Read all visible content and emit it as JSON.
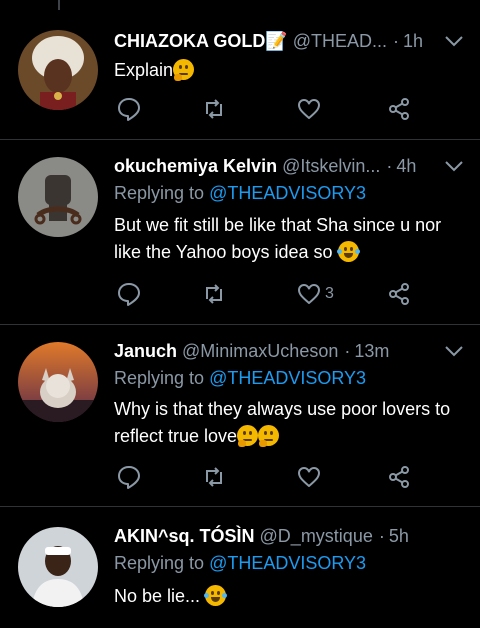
{
  "tweets": [
    {
      "name": "CHIAZOKA GOLD📝",
      "handle": "@THEAD...",
      "time": "1h",
      "replying_prefix": "",
      "replying_handle": "",
      "text": "Explain",
      "emojis": [
        "thinking"
      ],
      "like_count": ""
    },
    {
      "name": "okuchemiya Kelvin",
      "handle": "@Itskelvin...",
      "time": "4h",
      "replying_prefix": "Replying to",
      "replying_handle": "@THEADVISORY3",
      "text": "But we fit still be like that Sha since u nor like the Yahoo boys idea so",
      "emojis": [
        "laughing"
      ],
      "like_count": "3"
    },
    {
      "name": "Januch",
      "handle": "@MinimaxUcheson",
      "time": "13m",
      "replying_prefix": "Replying to",
      "replying_handle": "@THEADVISORY3",
      "text": "Why is that they always use poor lovers to reflect true love",
      "emojis": [
        "thinking",
        "thinking"
      ],
      "like_count": ""
    },
    {
      "name": "AKIN^sq. TÓSÌN",
      "handle": "@D_mystique",
      "time": "5h",
      "replying_prefix": "Replying to",
      "replying_handle": "@THEADVISORY3",
      "text": "No be lie...",
      "emojis": [
        "laughing"
      ],
      "like_count": ""
    }
  ],
  "time_separator": "·",
  "icons": {
    "reply": "reply-icon",
    "retweet": "retweet-icon",
    "like": "heart-icon",
    "share": "share-icon",
    "caret": "chevron-down-icon"
  },
  "colors": {
    "background": "#000000",
    "secondary_text": "#8b98a5",
    "mention": "#1d9bf0",
    "divider": "#2f3336"
  }
}
